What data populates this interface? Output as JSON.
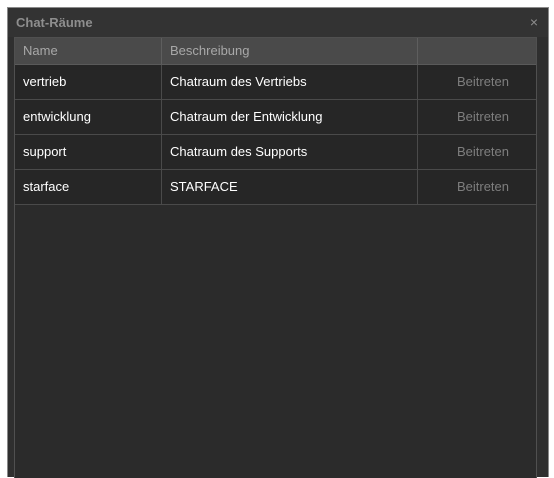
{
  "window": {
    "title": "Chat-Räume",
    "close_label": "×"
  },
  "table": {
    "columns": [
      "Name",
      "Beschreibung",
      ""
    ],
    "rows": [
      {
        "name": "vertrieb",
        "description": "Chatraum des Vertriebs",
        "action": "Beitreten"
      },
      {
        "name": "entwicklung",
        "description": "Chatraum der Entwicklung",
        "action": "Beitreten"
      },
      {
        "name": "support",
        "description": "Chatraum des Supports",
        "action": "Beitreten"
      },
      {
        "name": "starface",
        "description": "STARFACE",
        "action": "Beitreten"
      }
    ]
  },
  "colors": {
    "background": "#2f2f2f",
    "row_background": "#262626",
    "header_background": "#4a4a4a",
    "text": "#ffffff",
    "muted_text": "#7e7e7e"
  },
  "icons": {
    "close": "close-icon"
  }
}
